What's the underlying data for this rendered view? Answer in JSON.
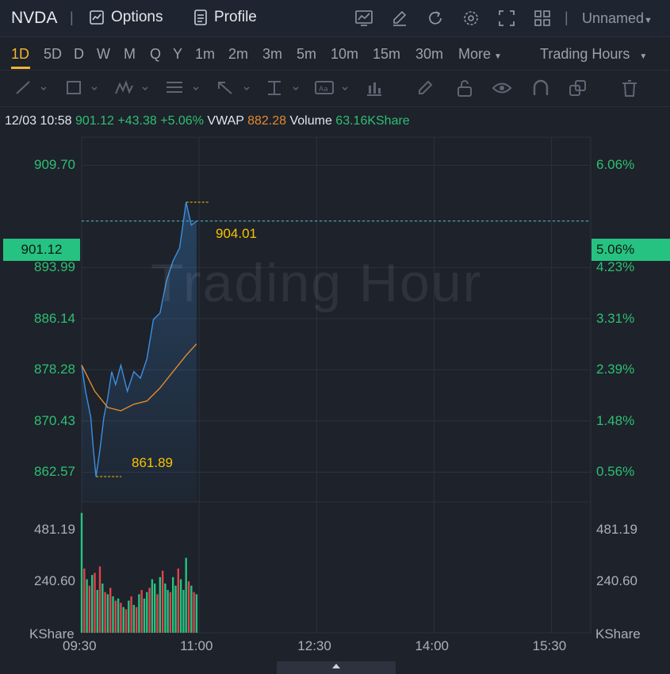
{
  "header": {
    "symbol": "NVDA",
    "separator": "|",
    "options_label": "Options",
    "profile_label": "Profile",
    "layout_label": "Unnamed",
    "icons": [
      "indicator-icon",
      "draw-icon",
      "refresh-icon",
      "settings-icon",
      "fullscreen-icon",
      "layout-grid-icon"
    ]
  },
  "timeframes": {
    "items": [
      "1D",
      "5D",
      "D",
      "W",
      "M",
      "Q",
      "Y",
      "1m",
      "2m",
      "3m",
      "5m",
      "10m",
      "15m",
      "30m"
    ],
    "active": "1D",
    "more_label": "More",
    "session_label": "Trading Hours"
  },
  "info": {
    "datetime": "12/03 10:58",
    "price": "901.12",
    "change": "+43.38",
    "change_pct": "+5.06%",
    "vwap_label": "VWAP",
    "vwap_value": "882.28",
    "volume_label": "Volume",
    "volume_value": "63.16KShare"
  },
  "chart": {
    "watermark": "Trading Hour",
    "current_price_tag": "901.12",
    "current_pct_tag": "5.06%",
    "high_label": "904.01",
    "low_label": "861.89",
    "volume_unit_left": "KShare",
    "volume_unit_right": "KShare",
    "colors": {
      "up": "#26c281",
      "down": "#e0434a",
      "line": "#3d8fe0",
      "vwap": "#e38a2e",
      "label": "#f5c400"
    }
  },
  "chart_data": {
    "type": "line",
    "price_axis_left": [
      "909.70",
      "901.12",
      "893.99",
      "886.14",
      "878.28",
      "870.43",
      "862.57"
    ],
    "price_axis_right": [
      "6.06%",
      "5.06%",
      "4.23%",
      "3.31%",
      "2.39%",
      "1.48%",
      "0.56%"
    ],
    "volume_axis_left": [
      "481.19",
      "240.60"
    ],
    "volume_axis_right": [
      "481.19",
      "240.60"
    ],
    "x_ticks": [
      "09:30",
      "11:00",
      "12:30",
      "14:00",
      "15:30"
    ],
    "price_series": [
      {
        "t": "09:30",
        "v": 879.0
      },
      {
        "t": "09:33",
        "v": 875.0
      },
      {
        "t": "09:35",
        "v": 873.0
      },
      {
        "t": "09:37",
        "v": 871.0
      },
      {
        "t": "09:39",
        "v": 866.0
      },
      {
        "t": "09:41",
        "v": 861.89
      },
      {
        "t": "09:44",
        "v": 866.0
      },
      {
        "t": "09:47",
        "v": 871.0
      },
      {
        "t": "09:50",
        "v": 874.0
      },
      {
        "t": "09:53",
        "v": 878.0
      },
      {
        "t": "09:56",
        "v": 876.0
      },
      {
        "t": "10:00",
        "v": 879.0
      },
      {
        "t": "10:05",
        "v": 875.0
      },
      {
        "t": "10:10",
        "v": 878.0
      },
      {
        "t": "10:15",
        "v": 877.0
      },
      {
        "t": "10:20",
        "v": 880.0
      },
      {
        "t": "10:25",
        "v": 886.0
      },
      {
        "t": "10:30",
        "v": 887.0
      },
      {
        "t": "10:35",
        "v": 892.0
      },
      {
        "t": "10:40",
        "v": 895.0
      },
      {
        "t": "10:45",
        "v": 897.0
      },
      {
        "t": "10:50",
        "v": 904.01
      },
      {
        "t": "10:54",
        "v": 900.5
      },
      {
        "t": "10:58",
        "v": 901.12
      }
    ],
    "vwap_series": [
      {
        "t": "09:30",
        "v": 879.0
      },
      {
        "t": "09:40",
        "v": 875.0
      },
      {
        "t": "09:50",
        "v": 872.5
      },
      {
        "t": "10:00",
        "v": 872.0
      },
      {
        "t": "10:10",
        "v": 873.0
      },
      {
        "t": "10:20",
        "v": 873.5
      },
      {
        "t": "10:30",
        "v": 875.5
      },
      {
        "t": "10:40",
        "v": 878.0
      },
      {
        "t": "10:50",
        "v": 880.5
      },
      {
        "t": "10:58",
        "v": 882.28
      }
    ],
    "volume_bars": [
      {
        "t": "09:30",
        "v": 560,
        "up": true
      },
      {
        "t": "09:32",
        "v": 300,
        "up": false
      },
      {
        "t": "09:34",
        "v": 250,
        "up": true
      },
      {
        "t": "09:36",
        "v": 220,
        "up": false
      },
      {
        "t": "09:38",
        "v": 270,
        "up": true
      },
      {
        "t": "09:40",
        "v": 280,
        "up": false
      },
      {
        "t": "09:42",
        "v": 200,
        "up": true
      },
      {
        "t": "09:44",
        "v": 310,
        "up": false
      },
      {
        "t": "09:46",
        "v": 230,
        "up": true
      },
      {
        "t": "09:48",
        "v": 190,
        "up": false
      },
      {
        "t": "09:50",
        "v": 180,
        "up": true
      },
      {
        "t": "09:52",
        "v": 210,
        "up": false
      },
      {
        "t": "09:54",
        "v": 170,
        "up": true
      },
      {
        "t": "09:56",
        "v": 150,
        "up": false
      },
      {
        "t": "09:58",
        "v": 160,
        "up": true
      },
      {
        "t": "10:00",
        "v": 140,
        "up": false
      },
      {
        "t": "10:02",
        "v": 120,
        "up": true
      },
      {
        "t": "10:04",
        "v": 110,
        "up": false
      },
      {
        "t": "10:06",
        "v": 150,
        "up": true
      },
      {
        "t": "10:08",
        "v": 170,
        "up": false
      },
      {
        "t": "10:10",
        "v": 130,
        "up": true
      },
      {
        "t": "10:12",
        "v": 120,
        "up": false
      },
      {
        "t": "10:14",
        "v": 180,
        "up": true
      },
      {
        "t": "10:16",
        "v": 200,
        "up": false
      },
      {
        "t": "10:18",
        "v": 160,
        "up": true
      },
      {
        "t": "10:20",
        "v": 190,
        "up": true
      },
      {
        "t": "10:22",
        "v": 210,
        "up": false
      },
      {
        "t": "10:24",
        "v": 250,
        "up": true
      },
      {
        "t": "10:26",
        "v": 230,
        "up": true
      },
      {
        "t": "10:28",
        "v": 180,
        "up": false
      },
      {
        "t": "10:30",
        "v": 260,
        "up": true
      },
      {
        "t": "10:32",
        "v": 290,
        "up": false
      },
      {
        "t": "10:34",
        "v": 230,
        "up": true
      },
      {
        "t": "10:36",
        "v": 200,
        "up": true
      },
      {
        "t": "10:38",
        "v": 190,
        "up": false
      },
      {
        "t": "10:40",
        "v": 260,
        "up": true
      },
      {
        "t": "10:42",
        "v": 220,
        "up": true
      },
      {
        "t": "10:44",
        "v": 300,
        "up": false
      },
      {
        "t": "10:46",
        "v": 250,
        "up": true
      },
      {
        "t": "10:48",
        "v": 200,
        "up": true
      },
      {
        "t": "10:50",
        "v": 350,
        "up": true
      },
      {
        "t": "10:52",
        "v": 240,
        "up": false
      },
      {
        "t": "10:54",
        "v": 220,
        "up": true
      },
      {
        "t": "10:56",
        "v": 190,
        "up": false
      },
      {
        "t": "10:58",
        "v": 180,
        "up": true
      }
    ],
    "price_ylim": [
      858.0,
      914.0
    ],
    "volume_ylim": [
      0,
      600
    ],
    "x_range": [
      "09:30",
      "16:00"
    ]
  }
}
